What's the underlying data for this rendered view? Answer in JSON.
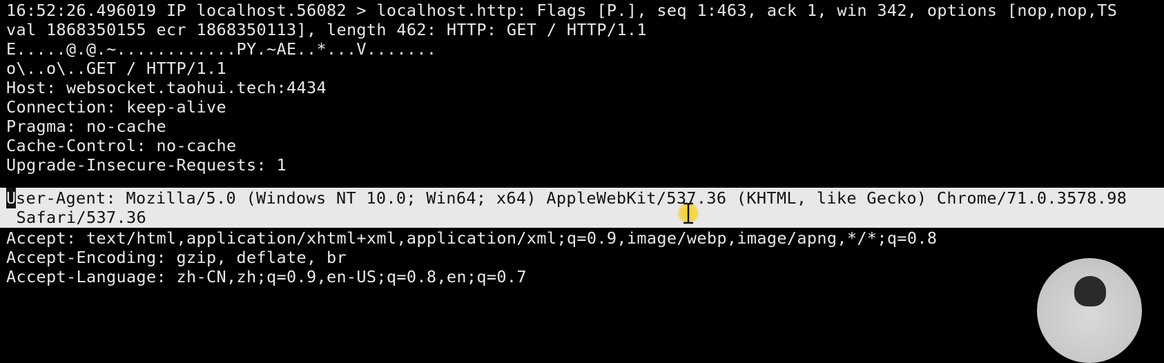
{
  "terminal": {
    "lines": [
      "16:52:26.496019 IP localhost.56082 > localhost.http: Flags [P.], seq 1:463, ack 1, win 342, options [nop,nop,TS",
      "val 1868350155 ecr 1868350113], length 462: HTTP: GET / HTTP/1.1",
      "E.....@.@.~............PY.~AE..*...V.......",
      "o\\..o\\..GET / HTTP/1.1",
      "Host: websocket.taohui.tech:4434",
      "Connection: keep-alive",
      "Pragma: no-cache",
      "Cache-Control: no-cache",
      "Upgrade-Insecure-Requests: 1"
    ],
    "highlighted": {
      "cursor_char": "U",
      "line1_rest": "ser-Agent: Mozilla/5.0 (Windows NT 10.0; Win64; x64) AppleWebKit/537.36 (KHTML, like Gecko) Chrome/71.0.3578.98",
      "line2": " Safari/537.36"
    },
    "after": [
      "Accept: text/html,application/xhtml+xml,application/xml;q=0.9,image/webp,image/apng,*/*;q=0.8",
      "Accept-Encoding: gzip, deflate, br",
      "Accept-Language: zh-CN,zh;q=0.9,en-US;q=0.8,en;q=0.7"
    ]
  },
  "colors": {
    "background": "#000000",
    "text": "#e9e9e9",
    "selection": "#e8e8e8",
    "selection_text": "#111111",
    "mouse_highlight": "#f6d026"
  },
  "icons": {
    "mouse_cursor": "i-beam-cursor-icon",
    "webcam": "webcam-overlay"
  }
}
